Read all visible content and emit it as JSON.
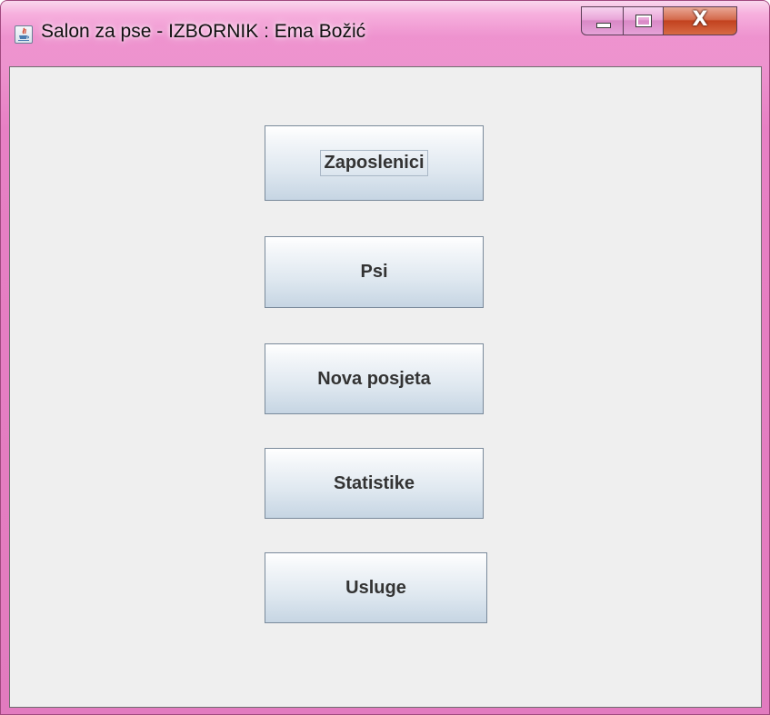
{
  "window": {
    "title": "Salon za pse - IZBORNIK : Ema Božić",
    "app_icon": "java-icon",
    "controls": {
      "minimize": "minimize-icon",
      "maximize": "maximize-icon",
      "close_label": "X"
    }
  },
  "menu": {
    "buttons": [
      {
        "id": "zaposlenici",
        "label": "Zaposlenici",
        "focused": true
      },
      {
        "id": "psi",
        "label": "Psi"
      },
      {
        "id": "nova-posjeta",
        "label": "Nova posjeta"
      },
      {
        "id": "statistike",
        "label": "Statistike"
      },
      {
        "id": "usluge",
        "label": "Usluge"
      }
    ]
  },
  "colors": {
    "frame": "#e27bbf",
    "content_bg": "#efefef",
    "button_text": "#333333",
    "close_button": "#c2421f"
  }
}
